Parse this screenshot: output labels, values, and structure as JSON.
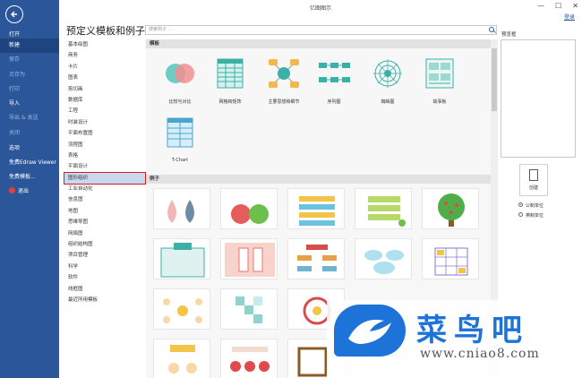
{
  "window": {
    "title": "亿图图示",
    "login": "登录",
    "minimize": "—",
    "maximize": "☐",
    "close": "✕"
  },
  "nav": {
    "back_icon": "arrow-left-icon",
    "items": [
      {
        "label": "打开",
        "state": "normal"
      },
      {
        "label": "新建",
        "state": "active"
      },
      {
        "label": "保存",
        "state": "dim"
      },
      {
        "label": "另存为",
        "state": "dim"
      },
      {
        "label": "打印",
        "state": "dim"
      },
      {
        "label": "导入",
        "state": "normal"
      },
      {
        "label": "导出 & 发送",
        "state": "dim"
      },
      {
        "label": "关闭",
        "state": "dim"
      },
      {
        "label": "选项",
        "state": "normal"
      },
      {
        "label": "免费Edraw Viewer",
        "state": "normal"
      },
      {
        "label": "免费模板...",
        "state": "normal"
      },
      {
        "label": "退出",
        "state": "normal"
      }
    ]
  },
  "main": {
    "title": "预定义模板和例子",
    "search_placeholder": "搜索例子 . . .",
    "categories": [
      "基本绘图",
      "商务",
      "卡片",
      "图表",
      "剪切画",
      "数据库",
      "工程",
      "时装设计",
      "平面布置图",
      "流程图",
      "表格",
      "平面设计",
      "图形组织",
      "工业自动化",
      "信息图",
      "地图",
      "思维导图",
      "网络图",
      "组织结构图",
      "项目管理",
      "科学",
      "软件",
      "线框图",
      "最近所用模板"
    ],
    "selected_category": "图形组织",
    "templates_header": "模板",
    "examples_header": "例子",
    "templates": [
      {
        "label": "比较与对比",
        "icon": "venn-icon"
      },
      {
        "label": "网格和矩阵",
        "icon": "matrix-icon"
      },
      {
        "label": "主要思想和细节",
        "icon": "main-idea-icon"
      },
      {
        "label": "序列图",
        "icon": "sequence-icon"
      },
      {
        "label": "蜘蛛图",
        "icon": "spider-icon"
      },
      {
        "label": "故事板",
        "icon": "storyboard-icon"
      },
      {
        "label": "T-Chart",
        "icon": "t-chart-icon"
      }
    ]
  },
  "preview": {
    "label": "预览框",
    "create_button": "创建",
    "unit_options": [
      {
        "label": "公制单位",
        "selected": true
      },
      {
        "label": "英制单位",
        "selected": false
      }
    ]
  },
  "watermark": {
    "text": "菜鸟吧",
    "url": "www.cniao8.com"
  },
  "colors": {
    "nav_bg": "#2b579a",
    "accent": "#2b579a",
    "selected_outline": "#d02020",
    "watermark": "#1e73d8"
  }
}
